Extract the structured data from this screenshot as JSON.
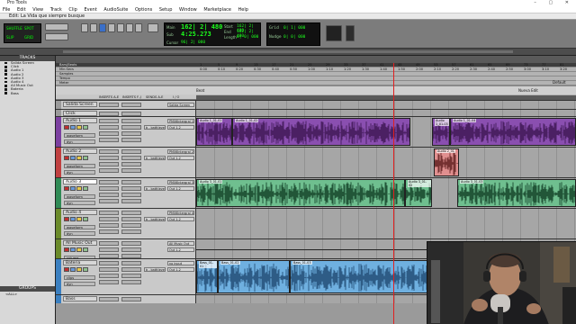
{
  "app": {
    "title": "Pro Tools",
    "doc_title": "Edit: La Vida que siempre busque",
    "window_controls": "– ▢ ✕"
  },
  "menu": [
    "File",
    "Edit",
    "View",
    "Track",
    "Clip",
    "Event",
    "AudioSuite",
    "Options",
    "Setup",
    "Window",
    "Marketplace",
    "Help"
  ],
  "counter": {
    "main_label": "Main",
    "main_value": "162| 2| 480",
    "sub_label": "Sub",
    "sub_value": "4:25.273",
    "start_label": "Start",
    "start_value": "162| 2| 480",
    "end_label": "End",
    "end_value": "162| 2| 480",
    "length_label": "Length",
    "length_value": "0| 0| 000",
    "cursor_label": "Cursor",
    "cursor_value": "96| 2| 080",
    "nudge_label": "Nudge",
    "nudge_value": "0| 0| 000",
    "grid_label": "Grid",
    "grid_value": "0| 1| 000"
  },
  "mode_buttons": [
    "SHUFFLE",
    "SPOT",
    "SLIP",
    "GRID"
  ],
  "tracklist": {
    "header": "TRACKS",
    "items": [
      "Salida Screen",
      "Click",
      "Audio 1",
      "Audio 2",
      "Audio 3",
      "Audio 4",
      "All Music Out",
      "Bateria",
      "Bass"
    ]
  },
  "groups": {
    "header": "GROUPS",
    "items": [
      "<ALL>"
    ]
  },
  "rulers": [
    {
      "name": "Bars|Beats",
      "ticks": [
        "1",
        "5",
        "9",
        "13",
        "17",
        "21",
        "25",
        "29",
        "33",
        "37",
        "41",
        "45",
        "49",
        "53",
        "57",
        "61",
        "65",
        "69",
        "73",
        "77",
        "81",
        "85"
      ]
    },
    {
      "name": "Min:Secs",
      "ticks": [
        "0:00",
        "0:10",
        "0:20",
        "0:30",
        "0:40",
        "0:50",
        "1:00",
        "1:10",
        "1:20",
        "1:30",
        "1:40",
        "1:50",
        "2:00",
        "2:10",
        "2:20",
        "2:30",
        "2:40",
        "2:50",
        "3:00",
        "3:10",
        "3:20"
      ]
    },
    {
      "name": "Samples",
      "ticks": []
    },
    {
      "name": "Tempo",
      "ticks": []
    },
    {
      "name": "Meter",
      "ticks": []
    },
    {
      "name": "Markers",
      "ticks": []
    }
  ],
  "markers": [
    {
      "label": "Beat"
    },
    {
      "label": "Nueva Edit"
    },
    {
      "label": "Default"
    }
  ],
  "column_headers": [
    "INSERTS A-E",
    "INSERTS F-J",
    "SENDS A-E",
    "I / O"
  ],
  "tracks": [
    {
      "name": "Salida Screen",
      "view": "",
      "io_in": "Salida Screen",
      "io_out": "Out 3-4",
      "color": "#9a9a9a",
      "clips": []
    },
    {
      "name": "Click",
      "view": "",
      "io_in": "",
      "io_out": "",
      "color": "#9a9a9a",
      "clips": []
    },
    {
      "name": "Audio 1",
      "view": "waveform",
      "sub": "dyn",
      "io_in": "PM06Intergral 1",
      "io_out": "Out 1-2",
      "send": "b - batttleve",
      "color": "#7b3fa0",
      "clips": [
        {
          "name": "Audio 1_01-01"
        },
        {
          "name": "Audio 1_01-02"
        },
        {
          "name": "Audio 1_01-03"
        },
        {
          "name": "Audio 1_01-04"
        }
      ]
    },
    {
      "name": "Audio 2",
      "view": "waveform",
      "sub": "dyn",
      "io_in": "PM06Intergral 2",
      "io_out": "Out 1-2",
      "send": "b - batttleve",
      "color": "#c04040",
      "clips": [
        {
          "name": "Audio 2_01"
        }
      ]
    },
    {
      "name": "Audio 3",
      "view": "waveform",
      "sub": "dyn",
      "io_in": "PM06Intergral 3",
      "io_out": "Out 1-2",
      "send": "b - batttleve",
      "color": "#2f8a55",
      "clips": [
        {
          "name": "Audio 3_01-01"
        },
        {
          "name": "Audio 3_01-02"
        },
        {
          "name": "Audio 3_01-03"
        }
      ]
    },
    {
      "name": "Audio 4",
      "view": "waveform",
      "sub": "dyn",
      "io_in": "PM06Intergral 4",
      "io_out": "Out 1-2",
      "send": "b - batttleve",
      "color": "#6a8a2a",
      "clips": []
    },
    {
      "name": "All Music Out",
      "view": "volume",
      "sub": "",
      "io_in": "All Music Out",
      "io_out": "Out 1-2",
      "send": "",
      "color": "#6a8a2a",
      "clips": []
    },
    {
      "name": "Bateria",
      "view": "clips",
      "sub": "dyn",
      "io_in": "no input",
      "io_out": "Out 1-2",
      "send": "b - batttleve",
      "color": "#3a7fc0",
      "clips": [
        {
          "name": "Bass_01-01"
        },
        {
          "name": "Bass_01-02"
        },
        {
          "name": "Bass_01-03"
        }
      ]
    },
    {
      "name": "Bass",
      "view": "",
      "io_in": "",
      "io_out": "",
      "color": "#3a7fc0",
      "clips": []
    }
  ]
}
